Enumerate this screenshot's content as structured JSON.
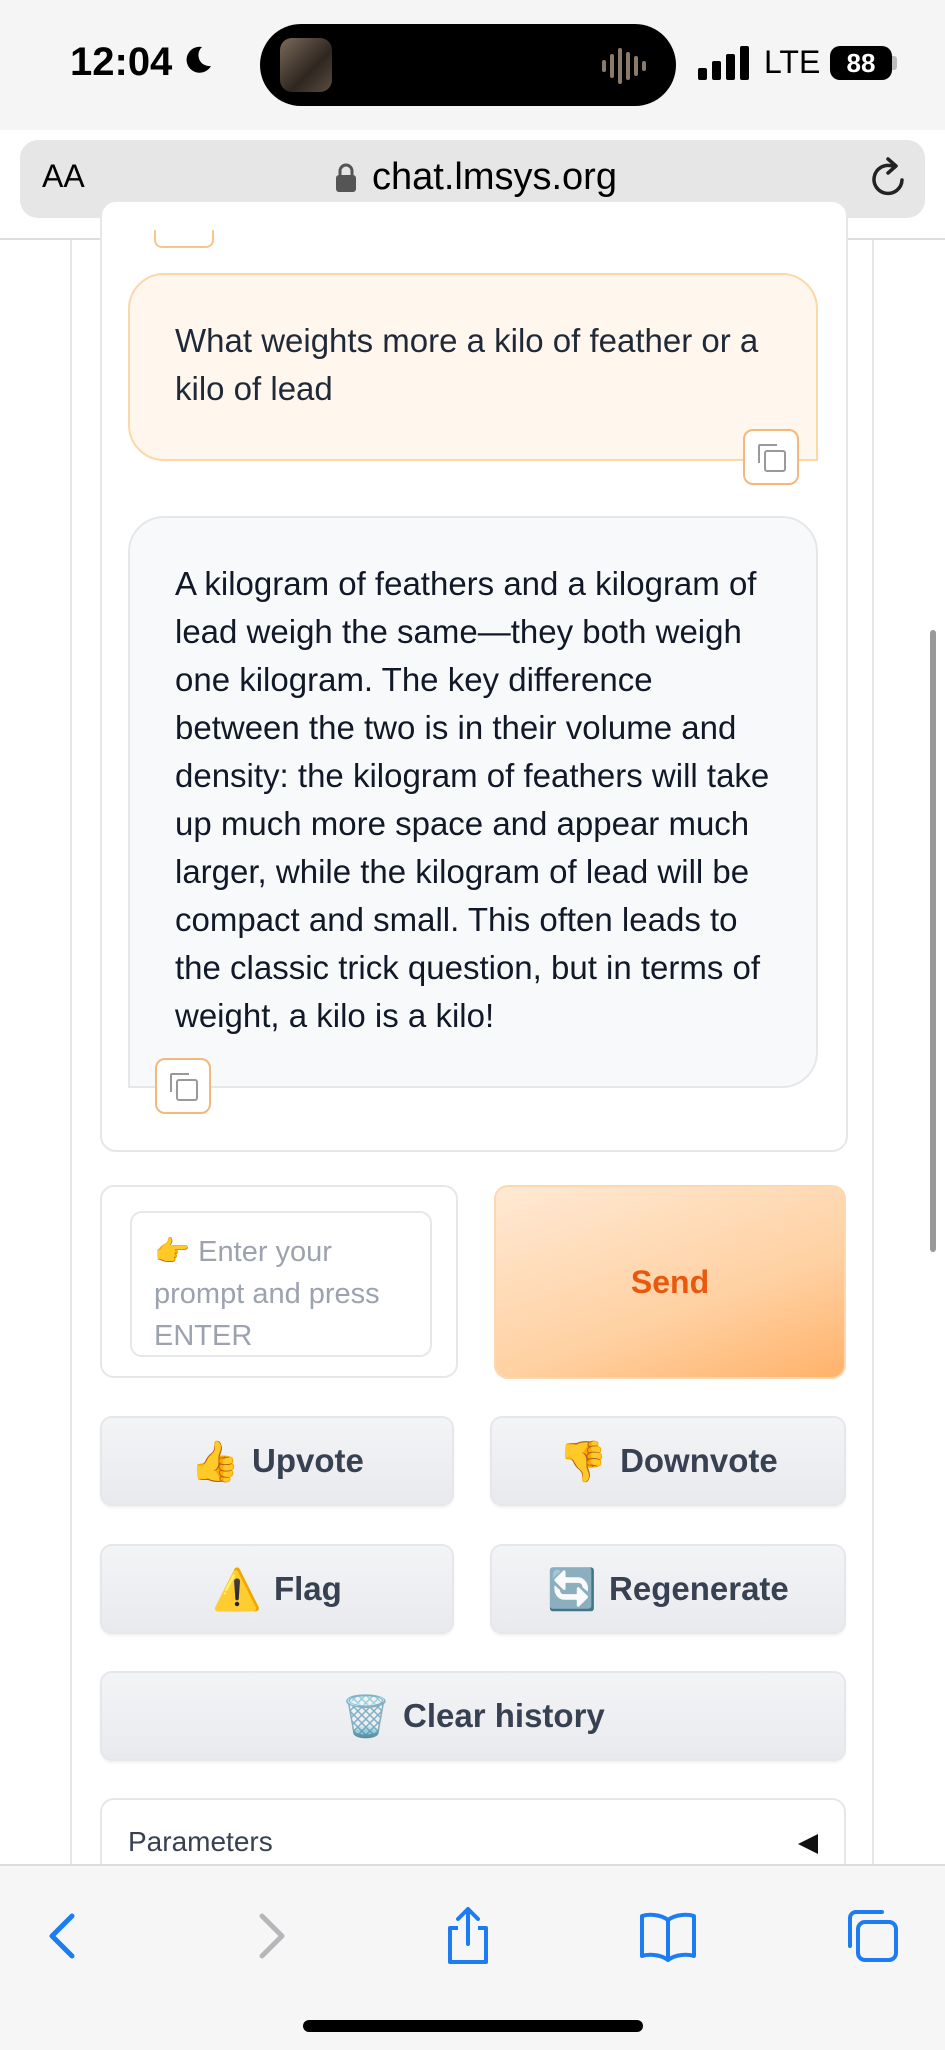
{
  "status_bar": {
    "time": "12:04",
    "network": "LTE",
    "battery": "88"
  },
  "browser": {
    "text_size_label": "AA",
    "url": "chat.lmsys.org"
  },
  "chat": {
    "user_message": "What weights more a kilo of feather or a kilo of lead",
    "assistant_message": "A kilogram of feathers and a kilogram of lead weigh the same—they both weigh one kilogram. The key difference between the two is in their volume and density: the kilogram of feathers will take up much more space and appear much larger, while the kilogram of lead will be compact and small. This often leads to the classic trick question, but in terms of weight, a kilo is a kilo!"
  },
  "input": {
    "placeholder": "👉 Enter your prompt and press ENTER",
    "send_label": "Send"
  },
  "actions": {
    "upvote": {
      "emoji": "👍",
      "label": "Upvote"
    },
    "downvote": {
      "emoji": "👎",
      "label": "Downvote"
    },
    "flag": {
      "emoji": "⚠️",
      "label": "Flag"
    },
    "regenerate": {
      "emoji": "🔄",
      "label": "Regenerate"
    },
    "clear": {
      "emoji": "🗑️",
      "label": "Clear history"
    }
  },
  "parameters": {
    "label": "Parameters"
  },
  "colors": {
    "accent": "#ea580c",
    "user_bubble": "#fff6ed",
    "bot_bubble": "#f8f9fb",
    "ios_blue": "#1e7cf2"
  }
}
